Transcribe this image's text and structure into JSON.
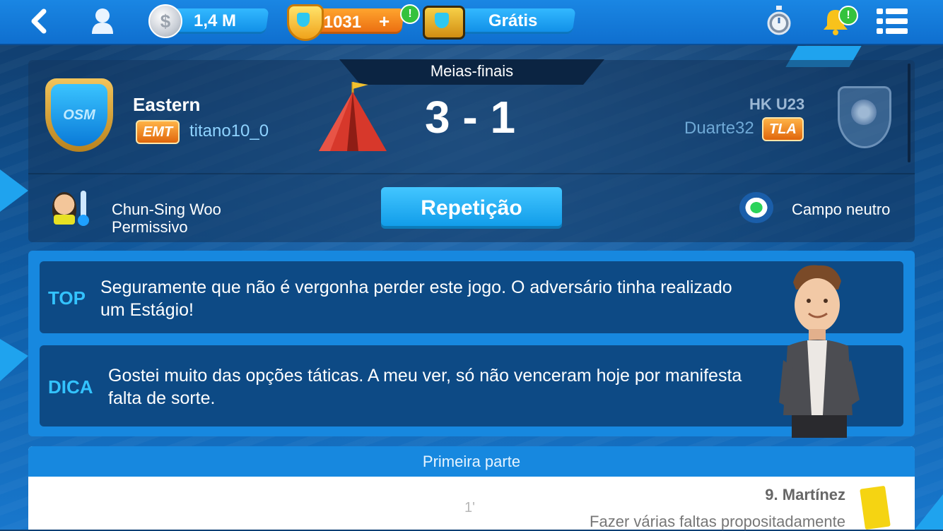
{
  "topbar": {
    "coins": "1,4 M",
    "coin_symbol": "$",
    "credits": "1031",
    "credits_plus": "+",
    "free_label": "Grátis",
    "alert_mark": "!"
  },
  "match": {
    "round": "Meias-finais",
    "home_team": "Eastern",
    "home_manager_tag": "EMT",
    "home_manager": "titano10_0",
    "home_badge_text": "OSM",
    "score": "3 - 1",
    "away_team": "HK U23",
    "away_manager": "Duarte32",
    "away_manager_tag": "TLA",
    "coach_name": "Chun-Sing Woo",
    "coach_style": "Permissivo",
    "replay_label": "Repetição",
    "venue": "Campo neutro"
  },
  "comments": [
    {
      "tag": "TOP",
      "text": "Seguramente que não é vergonha perder este jogo. O adversário tinha realizado um Estágio!"
    },
    {
      "tag": "DICA",
      "text": "Gostei muito das opções táticas. A meu ver, só não venceram hoje por manifesta falta de sorte."
    }
  ],
  "events": {
    "section_title": "Primeira parte",
    "items": [
      {
        "minute": "1'",
        "player": "9. Martínez",
        "description": "Fazer várias faltas propositadamente"
      }
    ]
  },
  "colors": {
    "accent": "#1788df",
    "tag": "#33c3ff",
    "dark_row": "#0d4a85"
  },
  "icons": {
    "back": "back-arrow-icon",
    "profile": "profile-icon",
    "coin": "coin-icon",
    "credits": "credits-shield-icon",
    "tv": "tv-icon",
    "timer": "stopwatch-icon",
    "bell": "bell-icon",
    "menu": "menu-icon",
    "tent": "tent-icon",
    "stadium": "stadium-icon",
    "card": "yellow-card-icon"
  }
}
